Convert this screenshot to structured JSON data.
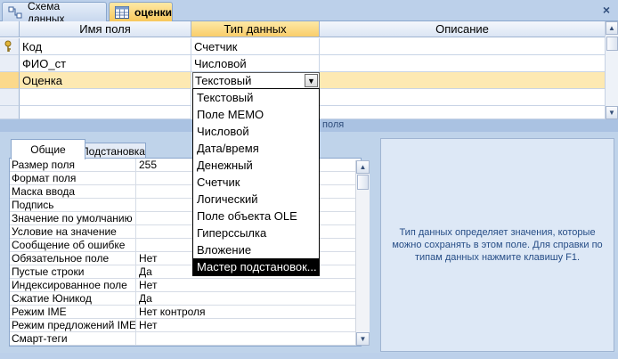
{
  "tabs": {
    "schema_label": "Схема данных",
    "table_label": "оценки",
    "close_glyph": "×"
  },
  "grid": {
    "headers": {
      "field_name": "Имя поля",
      "data_type": "Тип данных",
      "description": "Описание"
    },
    "rows": [
      {
        "name": "Код",
        "type": "Счетчик",
        "key": true
      },
      {
        "name": "ФИО_ст",
        "type": "Числовой",
        "key": false
      },
      {
        "name": "Оценка",
        "type": "Текстовый",
        "key": false
      }
    ],
    "combo_value": "Текстовый",
    "scroll_up": "▲",
    "scroll_down": "▼"
  },
  "dropdown": {
    "options": [
      "Текстовый",
      "Поле MEMO",
      "Числовой",
      "Дата/время",
      "Денежный",
      "Счетчик",
      "Логический",
      "Поле объекта OLE",
      "Гиперссылка",
      "Вложение",
      "Мастер подстановок..."
    ],
    "highlighted_index": 10
  },
  "caption_bar": {
    "text": "поля"
  },
  "lower_tabs": {
    "general": "Общие",
    "lookup": "Подстановка"
  },
  "properties": [
    {
      "label": "Размер поля",
      "value": "255"
    },
    {
      "label": "Формат поля",
      "value": ""
    },
    {
      "label": "Маска ввода",
      "value": ""
    },
    {
      "label": "Подпись",
      "value": ""
    },
    {
      "label": "Значение по умолчанию",
      "value": ""
    },
    {
      "label": "Условие на значение",
      "value": ""
    },
    {
      "label": "Сообщение об ошибке",
      "value": ""
    },
    {
      "label": "Обязательное поле",
      "value": "Нет"
    },
    {
      "label": "Пустые строки",
      "value": "Да"
    },
    {
      "label": "Индексированное поле",
      "value": "Нет"
    },
    {
      "label": "Сжатие Юникод",
      "value": "Да"
    },
    {
      "label": "Режим IME",
      "value": "Нет контроля"
    },
    {
      "label": "Режим предложений IME",
      "value": "Нет"
    },
    {
      "label": "Смарт-теги",
      "value": ""
    }
  ],
  "help": {
    "text": "Тип данных определяет значения, которые можно сохранять в этом поле.  Для справки по типам данных нажмите клавишу F1."
  },
  "colors": {
    "accent_active_tab": "#f8c85c",
    "highlight_option": "#000000",
    "help_text": "#264d86"
  }
}
